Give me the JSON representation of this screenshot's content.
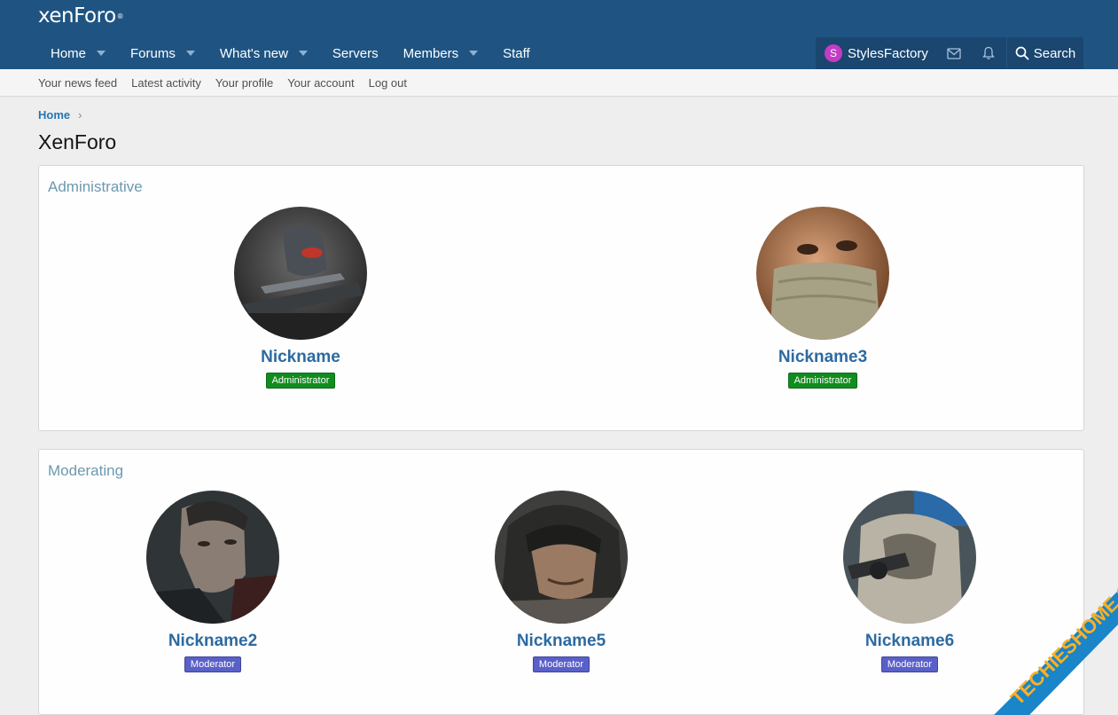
{
  "header": {
    "logo_text": "xenForo",
    "nav": [
      {
        "label": "Home",
        "has_dropdown": true
      },
      {
        "label": "Forums",
        "has_dropdown": true
      },
      {
        "label": "What's new",
        "has_dropdown": true
      },
      {
        "label": "Servers",
        "has_dropdown": false
      },
      {
        "label": "Members",
        "has_dropdown": true
      },
      {
        "label": "Staff",
        "has_dropdown": false
      }
    ],
    "user": {
      "initial": "S",
      "name": "StylesFactory"
    },
    "inbox_icon": "envelope-icon",
    "alerts_icon": "bell-icon",
    "search_label": "Search"
  },
  "subnav": [
    "Your news feed",
    "Latest activity",
    "Your profile",
    "Your account",
    "Log out"
  ],
  "breadcrumb": {
    "home": "Home",
    "chevron": "›"
  },
  "page_title": "XenForo",
  "sections": [
    {
      "title": "Administrative",
      "members": [
        {
          "name": "Nickname",
          "badge": "Administrator"
        },
        {
          "name": "Nickname3",
          "badge": "Administrator"
        }
      ]
    },
    {
      "title": "Moderating",
      "members": [
        {
          "name": "Nickname2",
          "badge": "Moderator"
        },
        {
          "name": "Nickname5",
          "badge": "Moderator"
        },
        {
          "name": "Nickname6",
          "badge": "Moderator"
        }
      ]
    }
  ],
  "watermark": "TECHIESHOME.COM",
  "colors": {
    "header_bg": "#1f5482",
    "accent_blue": "#2d6aa1",
    "admin_badge": "#118d1f",
    "moderator_badge": "#5a60c9",
    "section_title": "#6c99b0"
  }
}
